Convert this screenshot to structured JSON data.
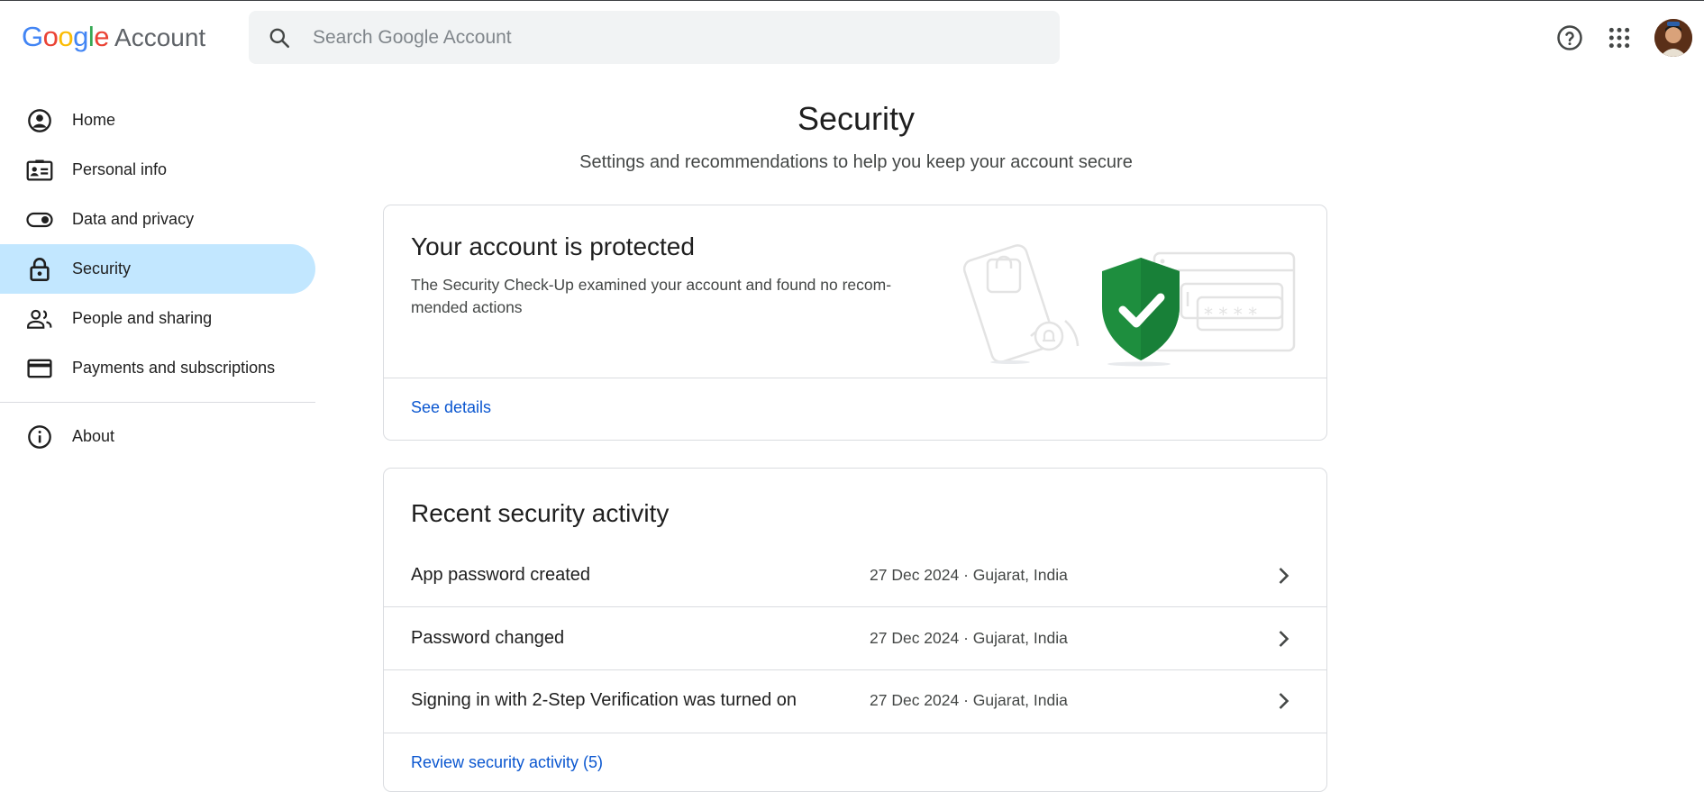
{
  "header": {
    "logo_google": "Google",
    "logo_account": "Account",
    "search_placeholder": "Search Google Account",
    "icons": [
      "help-icon",
      "apps-grid-icon",
      "avatar"
    ]
  },
  "sidebar": {
    "items": [
      {
        "label": "Home",
        "icon": "account-circle-icon"
      },
      {
        "label": "Personal info",
        "icon": "id-card-icon"
      },
      {
        "label": "Data and privacy",
        "icon": "toggle-icon"
      },
      {
        "label": "Security",
        "icon": "lock-icon",
        "active": true
      },
      {
        "label": "People and sharing",
        "icon": "people-icon"
      },
      {
        "label": "Payments and subscriptions",
        "icon": "credit-card-icon"
      }
    ],
    "about": {
      "label": "About",
      "icon": "info-icon"
    }
  },
  "main": {
    "title": "Security",
    "subtitle": "Settings and recommendations to help you keep your account secure",
    "protected_card": {
      "title": "Your account is protected",
      "description": "The Security Check-Up examined your account and found no recom-mended actions",
      "link": "See details"
    },
    "activity_card": {
      "title": "Recent security activity",
      "rows": [
        {
          "title": "App password created",
          "meta": "27 Dec 2024 · Gujarat, India"
        },
        {
          "title": "Password changed",
          "meta": "27 Dec 2024 · Gujarat, India"
        },
        {
          "title": "Signing in with 2-Step Verification was turned on",
          "meta": "27 Dec 2024 · Gujarat, India"
        }
      ],
      "link": "Review security activity (5)"
    }
  },
  "colors": {
    "accent_link": "#0b57d0",
    "active_nav": "#c2e7ff",
    "shield_green": "#1e8e3e"
  }
}
